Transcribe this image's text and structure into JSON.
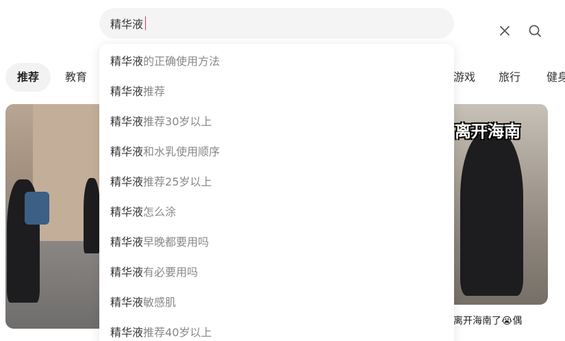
{
  "search": {
    "value": "精华液",
    "clear_icon": "close-icon",
    "submit_icon": "search-icon"
  },
  "tabs": [
    {
      "label": "推荐",
      "active": true
    },
    {
      "label": "教育",
      "active": false
    },
    {
      "label": "游戏",
      "active": false
    },
    {
      "label": "旅行",
      "active": false
    },
    {
      "label": "健身",
      "active": false
    }
  ],
  "suggestions": [
    {
      "keyword": "精华液",
      "rest": "的正确使用方法"
    },
    {
      "keyword": "精华液",
      "rest": "推荐"
    },
    {
      "keyword": "精华液",
      "rest": "推荐30岁以上"
    },
    {
      "keyword": "精华液",
      "rest": "和水乳使用顺序"
    },
    {
      "keyword": "精华液",
      "rest": "推荐25岁以上"
    },
    {
      "keyword": "精华液",
      "rest": "怎么涂"
    },
    {
      "keyword": "精华液",
      "rest": "早晚都要用吗"
    },
    {
      "keyword": "精华液",
      "rest": "有必要用吗"
    },
    {
      "keyword": "精华液",
      "rest": "敏感肌"
    },
    {
      "keyword": "精华液",
      "rest": "推荐40岁以上"
    }
  ],
  "feed": {
    "right_card": {
      "overlay_title": "离开海南",
      "caption": "离开海南了😭偶"
    }
  },
  "colors": {
    "accent": "#ff2442",
    "search_bg": "#f4f4f4",
    "tab_active_bg": "#f2f2f2",
    "suggestion_keyword": "#333333",
    "suggestion_rest": "#888888"
  }
}
